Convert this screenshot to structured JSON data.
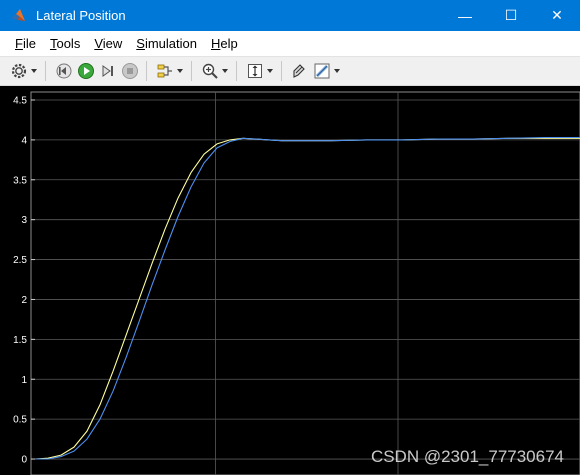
{
  "window": {
    "title": "Lateral Position",
    "minimize_glyph": "—",
    "maximize_glyph": "☐",
    "close_glyph": "✕"
  },
  "menu": [
    {
      "accel": "F",
      "rest": "ile"
    },
    {
      "accel": "T",
      "rest": "ools"
    },
    {
      "accel": "V",
      "rest": "iew"
    },
    {
      "accel": "S",
      "rest": "imulation"
    },
    {
      "accel": "H",
      "rest": "elp"
    }
  ],
  "toolbar": {
    "icons": [
      "settings-icon",
      "step-back-icon",
      "run-icon",
      "step-forward-icon",
      "stop-icon",
      "signal-lines-icon",
      "zoom-in-icon",
      "fit-axes-icon",
      "style-icon",
      "highlight-icon"
    ]
  },
  "colors": {
    "titlebar": "#0078d7",
    "plot_background": "#000000",
    "grid": "#5a5a5a",
    "series_yellow": "#ffff9c",
    "series_blue": "#4d8ff0"
  },
  "chart_data": {
    "type": "line",
    "ylim": [
      -0.2,
      4.6
    ],
    "xlim": [
      0,
      10
    ],
    "yticks": [
      "0",
      "0.5",
      "1",
      "1.5",
      "2",
      "2.5",
      "3",
      "3.5",
      "4",
      "4.5"
    ],
    "ytick_values": [
      0,
      0.5,
      1,
      1.5,
      2,
      2.5,
      3,
      3.5,
      4,
      4.5
    ],
    "xgrid_values": [
      5,
      10
    ],
    "grid": true,
    "series": [
      {
        "color": "#ffff9c",
        "x": [
          0,
          0.3,
          0.6,
          0.9,
          1.2,
          1.5,
          1.8,
          2.1,
          2.4,
          2.7,
          3.0,
          3.3,
          3.6,
          3.9,
          4.2,
          4.5,
          4.8,
          5.1,
          5.4,
          5.7,
          6.0,
          6.5,
          7.0,
          7.5,
          8.0,
          8.5,
          9.0,
          9.5,
          10.0
        ],
        "y": [
          0,
          0.01,
          0.05,
          0.15,
          0.35,
          0.68,
          1.1,
          1.55,
          2.0,
          2.45,
          2.88,
          3.27,
          3.59,
          3.82,
          3.95,
          4.0,
          4.02,
          4.01,
          4.0,
          3.99,
          3.99,
          3.99,
          4.0,
          4.0,
          4.01,
          4.01,
          4.02,
          4.02,
          4.02
        ]
      },
      {
        "color": "#4d8ff0",
        "x": [
          0,
          0.3,
          0.6,
          0.9,
          1.2,
          1.5,
          1.8,
          2.1,
          2.4,
          2.7,
          3.0,
          3.3,
          3.6,
          3.9,
          4.2,
          4.5,
          4.8,
          5.1,
          5.4,
          5.7,
          6.0,
          6.5,
          7.0,
          7.5,
          8.0,
          8.5,
          9.0,
          9.5,
          10.0
        ],
        "y": [
          0,
          0.0,
          0.03,
          0.1,
          0.25,
          0.5,
          0.85,
          1.27,
          1.72,
          2.18,
          2.62,
          3.04,
          3.41,
          3.71,
          3.9,
          3.98,
          4.02,
          4.01,
          4.0,
          3.99,
          3.99,
          3.99,
          4.0,
          4.0,
          4.01,
          4.01,
          4.02,
          4.03,
          4.03
        ]
      }
    ]
  },
  "watermark": "CSDN @2301_77730674"
}
